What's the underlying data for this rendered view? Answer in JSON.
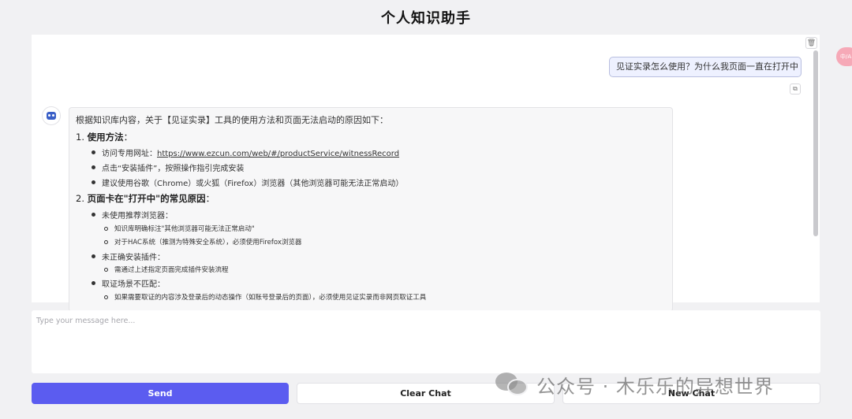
{
  "app": {
    "title": "个人知识助手"
  },
  "chat": {
    "user_message": "见证实录怎么使用？为什么我页面一直在打开中",
    "bot_message": {
      "intro": "根据知识库内容，关于【见证实录】工具的使用方法和页面无法启动的原因如下：",
      "section1": {
        "num": "1.",
        "title": "使用方法",
        "colon": "：",
        "item1_prefix": "访问专用网址：",
        "item1_link": "https://www.ezcun.com/web/#/productService/witnessRecord",
        "item2": "点击“安装插件”，按照操作指引完成安装",
        "item3": "建议使用谷歌（Chrome）或火狐（Firefox）浏览器（其他浏览器可能无法正常启动）"
      },
      "section2": {
        "num": "2.",
        "title": "页面卡在\"打开中\"的常见原因",
        "colon": "：",
        "sub1": {
          "label": "未使用推荐浏览器：",
          "items": [
            "知识库明确标注\"其他浏览器可能无法正常启动\"",
            "对于HAC系统（推测为特殊安全系统），必须使用Firefox浏览器"
          ]
        },
        "sub2": {
          "label": "未正确安装插件：",
          "items": [
            "需通过上述指定页面完成插件安装流程"
          ]
        },
        "sub3": {
          "label": "取证场景不匹配：",
          "items": [
            "如果需要取证的内容涉及登录后的动态操作（如账号登录后的页面），必须使用见证实录而非网页取证工具"
          ]
        }
      }
    }
  },
  "input": {
    "placeholder": "Type your message here..."
  },
  "buttons": {
    "send": "Send",
    "clear": "Clear Chat",
    "new": "New Chat"
  },
  "side_badge": {
    "text": "中/A"
  },
  "watermark": {
    "text": "公众号 · 木乐乐的异想世界"
  },
  "colors": {
    "accent": "#5b5cf0",
    "user_bubble": "#eef1ff",
    "background": "#f1f1f3"
  },
  "icons": {
    "trash": "trash-icon",
    "copy": "copy-icon",
    "avatar": "robot-icon",
    "wechat": "wechat-icon"
  }
}
